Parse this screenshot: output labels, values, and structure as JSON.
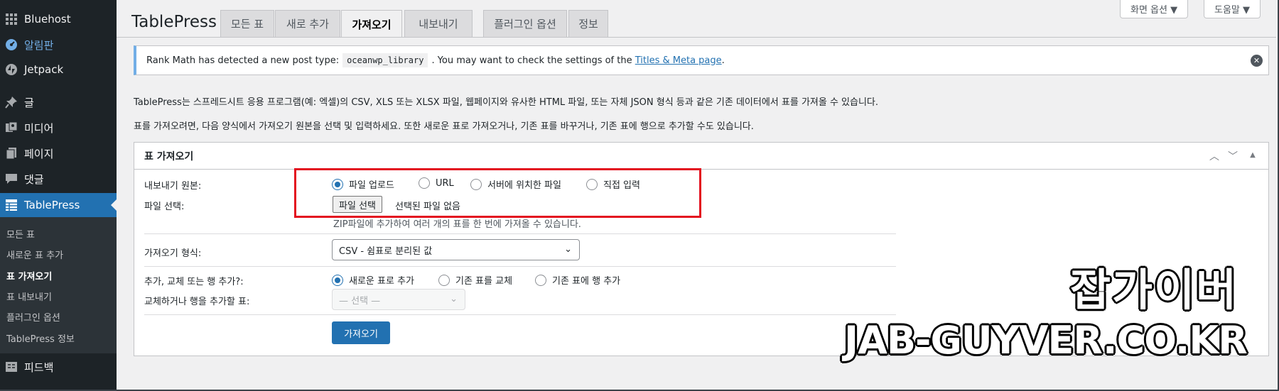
{
  "sidebar": {
    "items": [
      {
        "label": "Bluehost",
        "icon": "grid-icon"
      },
      {
        "label": "알림판",
        "icon": "dashboard-icon"
      },
      {
        "label": "Jetpack",
        "icon": "jetpack-icon"
      },
      {
        "label": "글",
        "icon": "pin-icon"
      },
      {
        "label": "미디어",
        "icon": "media-icon"
      },
      {
        "label": "페이지",
        "icon": "page-icon"
      },
      {
        "label": "댓글",
        "icon": "comment-icon"
      },
      {
        "label": "TablePress",
        "icon": "table-icon"
      },
      {
        "label": "피드백",
        "icon": "feedback-icon"
      }
    ],
    "submenu": [
      "모든 표",
      "새로운 표 추가",
      "표 가져오기",
      "표 내보내기",
      "플러그인 옵션",
      "TablePress 정보"
    ]
  },
  "screen_options": {
    "screen_label": "화면 옵션 ▼",
    "help_label": "도움말 ▼"
  },
  "page_title": "TablePress",
  "tabs": [
    "모든 표",
    "새로 추가",
    "가져오기",
    "내보내기",
    "플러그인 옵션",
    "정보"
  ],
  "notice": {
    "prefix": "Rank Math has detected a new post type:",
    "code": "oceanwp_library",
    "middle": ". You may want to check the settings of the",
    "link": "Titles & Meta page",
    "suffix": "."
  },
  "description": [
    "TablePress는 스프레드시트 응용 프로그램(예: 엑셀)의 CSV, XLS 또는 XLSX 파일, 웹페이지와 유사한 HTML 파일, 또는 자체 JSON 형식 등과 같은 기존 데이터에서 표를 가져올 수 있습니다.",
    "표를 가져오려면, 다음 양식에서 가져오기 원본을 선택 및 입력하세요. 또한 새로운 표로 가져오거나, 기존 표를 바꾸거나, 기존 표에 행으로 추가할 수도 있습니다."
  ],
  "import_box": {
    "title": "표 가져오기",
    "source_label": "내보내기 원본:",
    "source_options": [
      "파일 업로드",
      "URL",
      "서버에 위치한 파일",
      "직접 입력"
    ],
    "source_selected": "파일 업로드",
    "file_label": "파일 선택:",
    "file_button": "파일 선택",
    "file_status": "선택된 파일 없음",
    "file_hint": "ZIP파일에 추가하여 여러 개의 표를 한 번에 가져올 수 있습니다.",
    "format_label": "가져오기 형식:",
    "format_value": "CSV - 쉼표로 분리된 값",
    "mode_label": "추가, 교체 또는 행 추가?:",
    "mode_options": [
      "새로운 표로 추가",
      "기존 표를 교체",
      "기존 표에 행 추가"
    ],
    "mode_selected": "새로운 표로 추가",
    "target_label": "교체하거나 행을 추가할 표:",
    "target_value": "— 선택 —",
    "submit": "가져오기"
  },
  "watermark": {
    "line1": "잡가이버",
    "line2": "JAB-GUYVER.CO.KR"
  },
  "colors": {
    "sidebar": "#1d2327",
    "accent": "#2271b1",
    "highlight": "#e3101f"
  }
}
